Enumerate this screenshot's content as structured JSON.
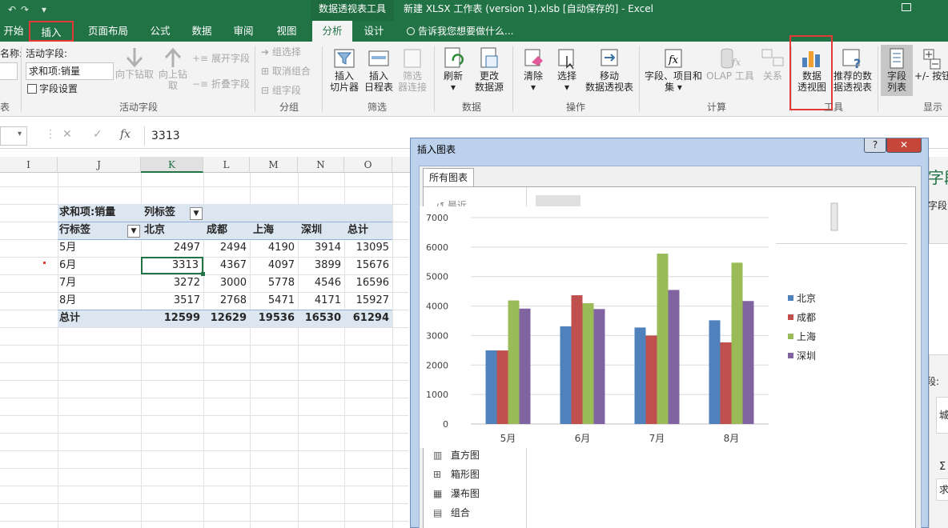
{
  "title_bar": {
    "context_tool": "数据透视表工具",
    "window_title": "新建 XLSX 工作表 (version 1).xlsb [自动保存的] - Excel",
    "qat_undo": "↶",
    "qat_redo": "↷",
    "qat_more": "▾"
  },
  "tabs": [
    {
      "label": "开始"
    },
    {
      "label": "插入"
    },
    {
      "label": "页面布局"
    },
    {
      "label": "公式"
    },
    {
      "label": "数据"
    },
    {
      "label": "审阅"
    },
    {
      "label": "视图"
    },
    {
      "label": "分析"
    },
    {
      "label": "设计"
    }
  ],
  "tell_me": "告诉我您想要做什么...",
  "ribbon": {
    "pivot_name_label": "名称:",
    "pivot_name_group": "表",
    "active_field_label": "活动字段:",
    "active_field_value": "求和项:销量",
    "field_settings": "字段设置",
    "drill_down": "向下钻取",
    "drill_up_1": "向上钻",
    "drill_up_2": "取",
    "expand_field": "展开字段",
    "collapse_field": "折叠字段",
    "group_active_field": "活动字段",
    "group_selection": "组选择",
    "ungroup": "取消组合",
    "group_field": "组字段",
    "group_group": "分组",
    "insert_slicer_1": "插入",
    "insert_slicer_2": "切片器",
    "insert_timeline_1": "插入",
    "insert_timeline_2": "日程表",
    "filter_connections_1": "筛选",
    "filter_connections_2": "器连接",
    "group_filter": "筛选",
    "refresh": "刷新",
    "change_source_1": "更改",
    "change_source_2": "数据源",
    "group_data": "数据",
    "clear": "清除",
    "select": "选择",
    "move_pivot_1": "移动",
    "move_pivot_2": "数据透视表",
    "group_actions": "操作",
    "fields_items_1": "字段、项目和",
    "fields_items_2": "集",
    "olap_tools": "OLAP 工具",
    "relationships": "关系",
    "group_calc": "计算",
    "pivot_chart_1": "数据",
    "pivot_chart_2": "透视图",
    "recommended_1": "推荐的数",
    "recommended_2": "据透视表",
    "group_tools": "工具",
    "field_list_1": "字段",
    "field_list_2": "列表",
    "buttons_label": "+/- 按钮",
    "group_show": "显示"
  },
  "formula_bar": {
    "fx": "fx",
    "value": "3313",
    "cancel": "✕",
    "enter": "✓"
  },
  "columns": [
    "I",
    "J",
    "K",
    "L",
    "M",
    "N",
    "O"
  ],
  "pivot": {
    "corner_label": "求和项:销量",
    "col_label": "列标签",
    "row_label": "行标签",
    "headers": [
      "北京",
      "成都",
      "上海",
      "深圳",
      "总计"
    ],
    "rows": [
      {
        "label": "5月",
        "values": [
          "2497",
          "2494",
          "4190",
          "3914",
          "13095"
        ]
      },
      {
        "label": "6月",
        "values": [
          "3313",
          "4367",
          "4097",
          "3899",
          "15676"
        ]
      },
      {
        "label": "7月",
        "values": [
          "3272",
          "3000",
          "5778",
          "4546",
          "16596"
        ]
      },
      {
        "label": "8月",
        "values": [
          "3517",
          "2768",
          "5471",
          "4171",
          "15927"
        ]
      }
    ],
    "total": {
      "label": "总计",
      "values": [
        "12599",
        "12629",
        "19536",
        "16530",
        "61294"
      ]
    }
  },
  "dialog": {
    "title": "插入图表",
    "tab": "所有图表",
    "help": "?",
    "close": "✕",
    "recent": "最近",
    "side_items": [
      "直方图",
      "箱形图",
      "瀑布图",
      "组合"
    ]
  },
  "right_pane": {
    "title": "字段",
    "label_fields": "字段:",
    "label_section": "段:",
    "sigma": "Σ",
    "item_a": "城",
    "item_b": "求"
  },
  "chart_data": {
    "type": "bar",
    "categories": [
      "5月",
      "6月",
      "7月",
      "8月"
    ],
    "series": [
      {
        "name": "北京",
        "color": "#4f81bd",
        "values": [
          2497,
          3313,
          3272,
          3517
        ]
      },
      {
        "name": "成都",
        "color": "#c0504d",
        "values": [
          2494,
          4367,
          3000,
          2768
        ]
      },
      {
        "name": "上海",
        "color": "#9bbb59",
        "values": [
          4190,
          4097,
          5778,
          5471
        ]
      },
      {
        "name": "深圳",
        "color": "#8064a2",
        "values": [
          3914,
          3899,
          4546,
          4171
        ]
      }
    ],
    "ylim": [
      0,
      7000
    ],
    "yticks": [
      "0",
      "1000",
      "2000",
      "3000",
      "4000",
      "5000",
      "6000",
      "7000"
    ],
    "grid": true,
    "legend": "right"
  }
}
